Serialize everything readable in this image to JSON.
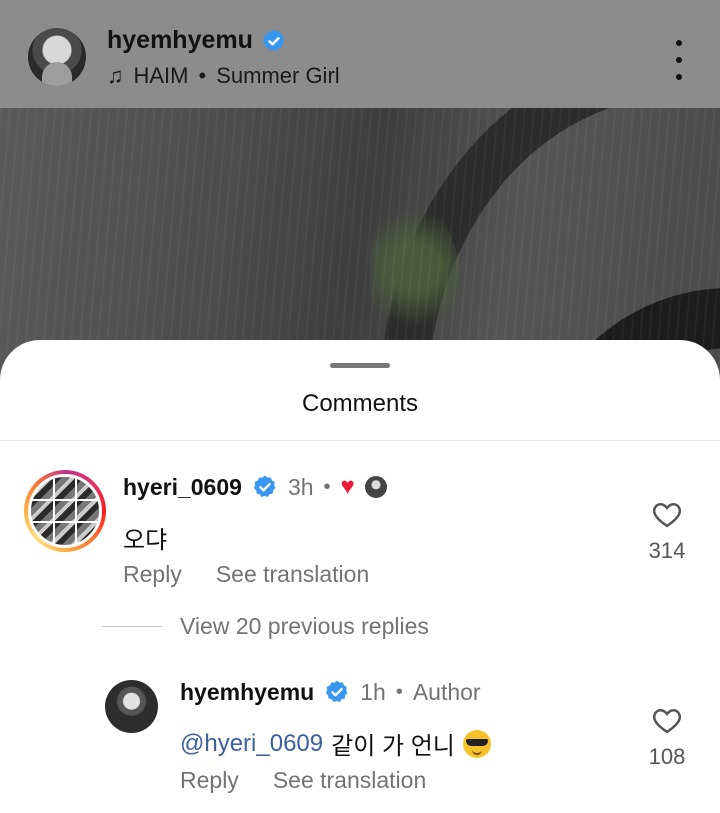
{
  "post": {
    "username": "hyemhyemu",
    "verified": true,
    "music": {
      "artist": "HAIM",
      "separator": "•",
      "track": "Summer Girl",
      "icon": "music-note-icon"
    },
    "more_icon": "more-vertical-icon"
  },
  "comments_sheet": {
    "title": "Comments"
  },
  "comments": [
    {
      "username": "hyeri_0609",
      "verified": true,
      "time": "3h",
      "separator": "•",
      "liked_by_author": true,
      "text": "오댜",
      "like_count": "314",
      "actions": {
        "reply": "Reply",
        "translate": "See translation"
      }
    }
  ],
  "view_replies": "View 20 previous replies",
  "reply": {
    "username": "hyemhyemu",
    "verified": true,
    "time": "1h",
    "separator": "•",
    "author_label": "Author",
    "mention": "@hyeri_0609",
    "text": "같이 가 언니",
    "emoji": "smiling-face-with-sunglasses",
    "like_count": "108",
    "actions": {
      "reply": "Reply",
      "translate": "See translation"
    }
  },
  "colors": {
    "verified_blue": "#3897f0",
    "like_red": "#ed1c3a",
    "mention_blue": "#3c5f9e",
    "secondary_text": "#737373"
  }
}
